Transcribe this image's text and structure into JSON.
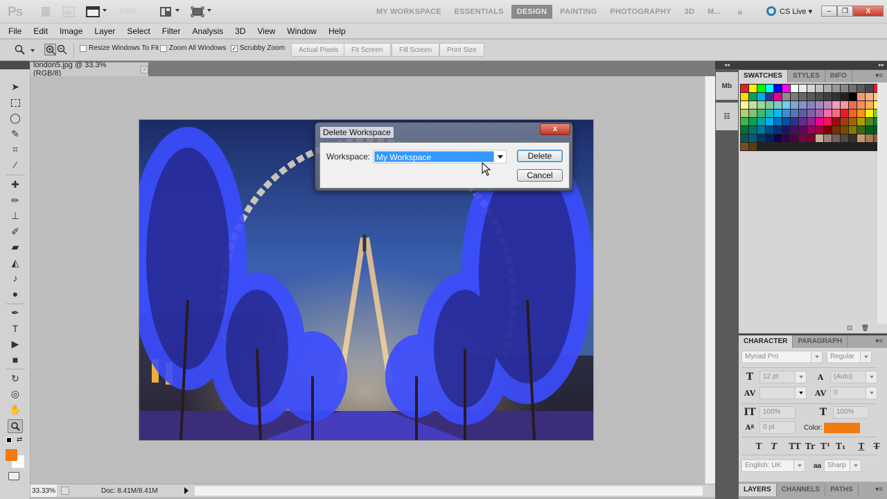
{
  "app": {
    "logo": "Ps",
    "zoom_level": "100%",
    "workspaces": [
      "MY WORKSPACE",
      "ESSENTIALS",
      "DESIGN",
      "PAINTING",
      "PHOTOGRAPHY",
      "3D",
      "M..."
    ],
    "active_workspace": "DESIGN",
    "more": "»",
    "cs_live": "CS Live ▾",
    "window_controls": {
      "minimize": "–",
      "restore": "❐",
      "close": "X"
    }
  },
  "menu": [
    "File",
    "Edit",
    "Image",
    "Layer",
    "Select",
    "Filter",
    "Analysis",
    "3D",
    "View",
    "Window",
    "Help"
  ],
  "options_bar": {
    "resize_windows": {
      "label": "Resize Windows To Fit",
      "checked": false
    },
    "zoom_all": {
      "label": "Zoom All Windows",
      "checked": false
    },
    "scrubby_zoom": {
      "label": "Scrubby Zoom",
      "checked": true,
      "mark": "✓"
    },
    "buttons": [
      "Actual Pixels",
      "Fit Screen",
      "Fill Screen",
      "Print Size"
    ]
  },
  "document": {
    "tab_title": "london5.jpg @ 33.3% (RGB/8)",
    "close": "×",
    "status_zoom": "33.33%",
    "status_doc": "Doc: 8.41M/8.41M"
  },
  "dialog": {
    "title": "Delete Workspace",
    "close": "x",
    "label": "Workspace:",
    "selected": "My Workspace",
    "delete_label": "Delete",
    "cancel_label": "Cancel"
  },
  "tools": [
    "move",
    "marquee",
    "lasso",
    "quick-select",
    "crop",
    "eyedropper",
    "healing-brush",
    "brush",
    "clone-stamp",
    "history-brush",
    "eraser",
    "paint-bucket",
    "dodge",
    "pen",
    "type",
    "path-selection",
    "rectangle",
    "3d-rotate",
    "3d-orbit",
    "hand",
    "zoom"
  ],
  "colors": {
    "foreground": "#f07b10",
    "background": "#ffffff",
    "accent": "#3399ff"
  },
  "swatches_panel": {
    "tabs": [
      "SWATCHES",
      "STYLES",
      "INFO"
    ],
    "active": "SWATCHES",
    "colors": [
      "#ed1c24",
      "#fff200",
      "#00ff00",
      "#00ffff",
      "#0000ff",
      "#ff00ff",
      "#ffffff",
      "#ebebeb",
      "#d7d7d7",
      "#c2c2c2",
      "#adadad",
      "#999999",
      "#858585",
      "#707070",
      "#5c5c5c",
      "#474747",
      "#ed1c24",
      "#ffd800",
      "#00a651",
      "#00aeef",
      "#2e3192",
      "#ec008c",
      "#8c8c8c",
      "#7a7a7a",
      "#666666",
      "#595959",
      "#4d4d4d",
      "#3f3f3f",
      "#333333",
      "#222222",
      "#000000",
      "#f7977a",
      "#f9ad81",
      "#f9c89f",
      "#fff79a",
      "#c4df9b",
      "#a3d39c",
      "#82ca9c",
      "#7accc8",
      "#6dcff6",
      "#7da7d9",
      "#8393ca",
      "#8781bd",
      "#a187be",
      "#bd8cbf",
      "#f49ac1",
      "#f5989d",
      "#f26c4f",
      "#f68e56",
      "#fbaf5d",
      "#fff568",
      "#acd373",
      "#7cc576",
      "#3cb878",
      "#1cbbb4",
      "#00bff3",
      "#448ccb",
      "#5574b9",
      "#605ca8",
      "#855fa8",
      "#a864a8",
      "#f06eaa",
      "#f26d7d",
      "#ed1c24",
      "#f26522",
      "#f7941d",
      "#fff200",
      "#8dc63f",
      "#39b54a",
      "#00a651",
      "#00a99d",
      "#00aeef",
      "#0072bc",
      "#0054a6",
      "#2e3192",
      "#662d91",
      "#92278f",
      "#ec008c",
      "#ed145b",
      "#9e0b0f",
      "#a0410d",
      "#a36209",
      "#aba000",
      "#598527",
      "#197b30",
      "#007236",
      "#00746b",
      "#0076a3",
      "#004b80",
      "#003471",
      "#1b1464",
      "#440e62",
      "#630460",
      "#9e005d",
      "#9e0039",
      "#790000",
      "#7b2e00",
      "#7d4900",
      "#827b00",
      "#406618",
      "#005e20",
      "#005826",
      "#005952",
      "#005b7f",
      "#003663",
      "#002157",
      "#0d004c",
      "#32004b",
      "#4b0049",
      "#7b0046",
      "#7a0026",
      "#c7b299",
      "#998675",
      "#736357",
      "#534741",
      "#37302d",
      "#c69c6d",
      "#a67c52",
      "#8c6239",
      "#754c24",
      "#603913"
    ]
  },
  "character_panel": {
    "tabs": [
      "CHARACTER",
      "PARAGRAPH"
    ],
    "active": "CHARACTER",
    "font_family": "Myriad Pro",
    "font_style": "Regular",
    "font_size": "12 pt",
    "leading": "(Auto)",
    "kerning": "",
    "tracking": "0",
    "vertical_scale": "100%",
    "horizontal_scale": "100%",
    "baseline_shift": "0 pt",
    "color_label": "Color:",
    "color": "#f07b10",
    "style_buttons": [
      "T",
      "T",
      "TT",
      "Tr",
      "T¹",
      "T₁",
      "T",
      "T"
    ],
    "language": "English: UK",
    "aa_icon": "aa",
    "antialias": "Sharp"
  },
  "layers_panel": {
    "tabs": [
      "LAYERS",
      "CHANNELS",
      "PATHS"
    ],
    "active": "LAYERS"
  }
}
